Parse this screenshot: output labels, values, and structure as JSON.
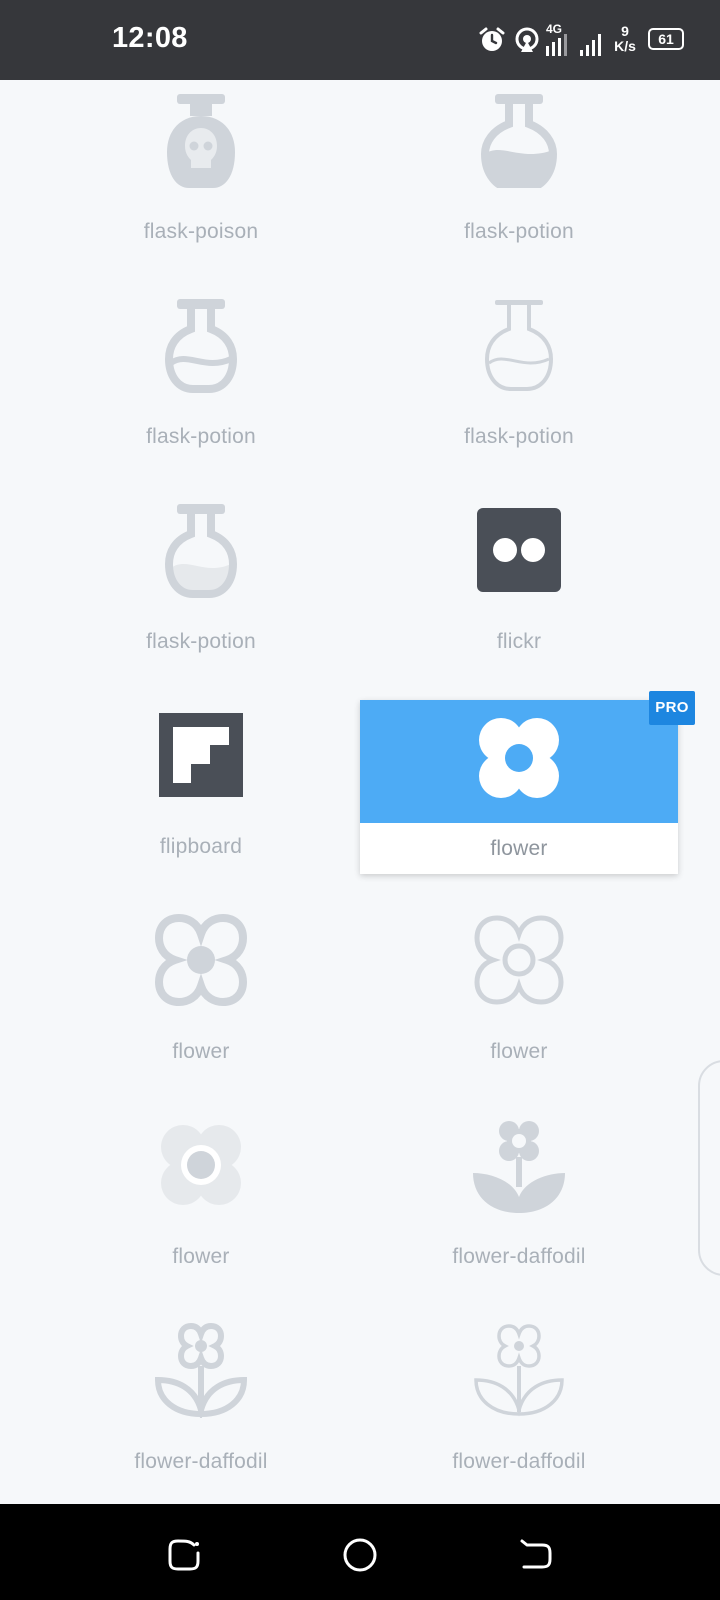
{
  "status_bar": {
    "time": "12:08",
    "network_type": "4G",
    "net_speed_value": "9",
    "net_speed_unit": "K/s",
    "battery": "61"
  },
  "icons": [
    {
      "label": "flask-poison",
      "icon": "flask-poison-icon"
    },
    {
      "label": "flask-potion",
      "icon": "flask-potion-icon"
    },
    {
      "label": "flask-potion",
      "icon": "flask-potion-outline-icon"
    },
    {
      "label": "flask-potion",
      "icon": "flask-potion-thin-icon"
    },
    {
      "label": "flask-potion",
      "icon": "flask-potion-duotone-icon"
    },
    {
      "label": "flickr",
      "icon": "flickr-icon"
    },
    {
      "label": "flipboard",
      "icon": "flipboard-icon"
    },
    {
      "label": "flower",
      "icon": "flower-icon",
      "selected": true,
      "badge": "PRO"
    },
    {
      "label": "flower",
      "icon": "flower-outline-icon"
    },
    {
      "label": "flower",
      "icon": "flower-thin-icon"
    },
    {
      "label": "flower",
      "icon": "flower-duotone-icon"
    },
    {
      "label": "flower-daffodil",
      "icon": "flower-daffodil-icon"
    },
    {
      "label": "flower-daffodil",
      "icon": "flower-daffodil-outline-icon"
    },
    {
      "label": "flower-daffodil",
      "icon": "flower-daffodil-thin-icon"
    }
  ],
  "colors": {
    "icon_gray": "#cfd4da",
    "icon_light": "#e6e9ec",
    "brand_dark": "#4a4f57",
    "selected_bg": "#4dabf5",
    "pro_badge": "#1d86e0"
  },
  "nav": {
    "recent": "recent-apps-icon",
    "home": "home-icon",
    "back": "back-icon"
  }
}
